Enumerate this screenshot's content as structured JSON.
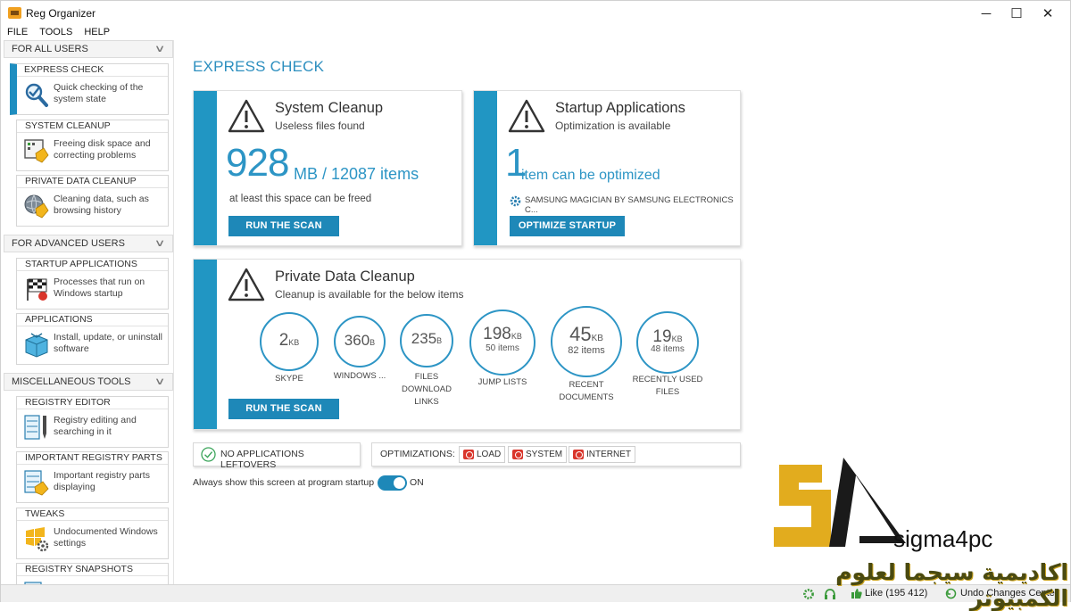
{
  "window": {
    "title": "Reg Organizer",
    "minimize_glyph": "─",
    "maximize_glyph": "☐",
    "close_glyph": "✕"
  },
  "menu": [
    "FILE",
    "TOOLS",
    "HELP"
  ],
  "sidebar": {
    "sections": [
      {
        "header": "FOR ALL USERS",
        "items": [
          {
            "title": "EXPRESS CHECK",
            "desc": "Quick checking of the system state",
            "icon": "magnifier-check-icon",
            "active": true
          },
          {
            "title": "SYSTEM CLEANUP",
            "desc": "Freeing disk space and correcting problems",
            "icon": "disk-broom-icon"
          },
          {
            "title": "PRIVATE DATA CLEANUP",
            "desc": "Cleaning data, such as browsing history",
            "icon": "globe-broom-icon"
          }
        ]
      },
      {
        "header": "FOR ADVANCED USERS",
        "items": [
          {
            "title": "STARTUP APPLICATIONS",
            "desc": "Processes that run on Windows startup",
            "icon": "race-flag-icon"
          },
          {
            "title": "APPLICATIONS",
            "desc": "Install, update, or uninstall software",
            "icon": "box-icon"
          }
        ]
      },
      {
        "header": "MISCELLANEOUS TOOLS",
        "items": [
          {
            "title": "REGISTRY EDITOR",
            "desc": "Registry editing and searching in it",
            "icon": "registry-editor-icon"
          },
          {
            "title": "IMPORTANT REGISTRY PARTS",
            "desc": "Important registry parts displaying",
            "icon": "registry-parts-icon"
          },
          {
            "title": "TWEAKS",
            "desc": "Undocumented Windows settings",
            "icon": "windows-gear-icon"
          },
          {
            "title": "REGISTRY SNAPSHOTS",
            "desc": "",
            "icon": "registry-snapshot-icon"
          }
        ]
      }
    ]
  },
  "main": {
    "title": "EXPRESS CHECK",
    "system_cleanup": {
      "title": "System Cleanup",
      "subtitle": "Useless files found",
      "size_value": "928",
      "size_unit": "MB / 12087 items",
      "note": "at least this space can be freed",
      "button": "RUN THE SCAN"
    },
    "startup": {
      "title": "Startup Applications",
      "subtitle": "Optimization is available",
      "count": "1",
      "count_text": "item can be optimized",
      "app_name": "SAMSUNG MAGICIAN BY SAMSUNG ELECTRONICS C...",
      "button": "OPTIMIZE STARTUP"
    },
    "private_data": {
      "title": "Private Data Cleanup",
      "subtitle": "Cleanup is available for the below items",
      "button": "RUN THE SCAN",
      "circles": [
        {
          "value": "2",
          "unit": "KB",
          "items": "",
          "label": "SKYPE"
        },
        {
          "value": "360",
          "unit": "B",
          "items": "",
          "label": "WINDOWS ..."
        },
        {
          "value": "235",
          "unit": "B",
          "items": "",
          "label": "FILES DOWNLOAD LINKS"
        },
        {
          "value": "198",
          "unit": "KB",
          "items": "50 items",
          "label": "JUMP LISTS"
        },
        {
          "value": "45",
          "unit": "KB",
          "items": "82 items",
          "label": "RECENT DOCUMENTS"
        },
        {
          "value": "19",
          "unit": "KB",
          "items": "48 items",
          "label": "RECENTLY USED FILES"
        }
      ]
    },
    "leftovers": "NO APPLICATIONS LEFTOVERS",
    "optimizations": {
      "label": "OPTIMIZATIONS:",
      "items": [
        "LOAD",
        "SYSTEM",
        "INTERNET"
      ]
    },
    "startup_toggle": {
      "label": "Always show this screen at program startup",
      "state": "ON"
    }
  },
  "statusbar": {
    "like": "Like (195 412)",
    "undo": "Undo Changes Center"
  },
  "watermark": {
    "site": "sigma4pc",
    "arabic": "اكاديمية سيجما لعلوم الكمبيوتر"
  },
  "colors": {
    "accent": "#2196c3",
    "button": "#1e88b8",
    "warning_red": "#d9352b",
    "check_green": "#3aa45a"
  }
}
